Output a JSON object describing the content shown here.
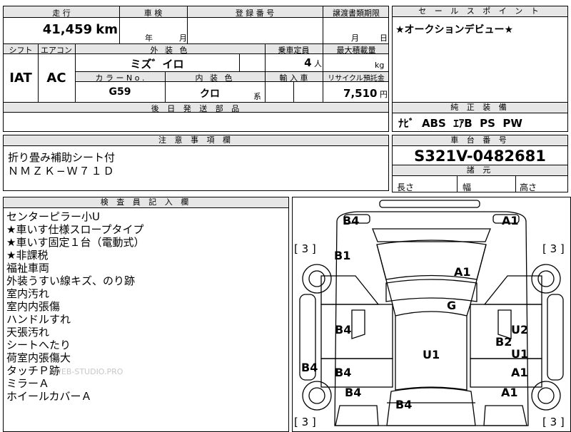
{
  "mileage": {
    "label": "走 行",
    "value": "41,459",
    "unit": "km"
  },
  "inspection": {
    "label": "車 検",
    "year_unit": "年",
    "month_unit": "月"
  },
  "registration": {
    "label": "登 録 番 号"
  },
  "transfer_deadline": {
    "label": "譲渡書類期限",
    "month_unit": "月",
    "day_unit": "日"
  },
  "shift": {
    "label": "シフト",
    "value": "IAT"
  },
  "aircon": {
    "label": "エアコン",
    "value": "AC"
  },
  "exterior_color": {
    "label": "外 装 色",
    "value": "ミズ゛イロ"
  },
  "seating": {
    "label": "乗車定員",
    "value": "4",
    "unit": "人"
  },
  "max_load": {
    "label": "最大積載量",
    "unit": "kg"
  },
  "color_no": {
    "label": "カ ラ ー N o .",
    "value": "G59"
  },
  "interior_color": {
    "label": "内 装 色",
    "value": "クロ",
    "suffix": "系"
  },
  "import": {
    "label": "輸 入 車"
  },
  "recycle": {
    "label": "リサイクル預託金",
    "value": "7,510",
    "unit": "円"
  },
  "later_parts": {
    "label": "後 日 発 送 部 品"
  },
  "sales_point": {
    "label": "セ ー ル ス ポ イ ン ト",
    "text": "★オークションデビュー★"
  },
  "factory_equipment": {
    "label": "純 正 装 備",
    "text": "ﾅﾋﾞ  ABS  ｴｱB  PS  PW"
  },
  "notes": {
    "label": "注 意 事 項 欄",
    "lines": [
      "折り畳み補助シート付",
      "ＮＭＺＫ−Ｗ７１Ｄ"
    ]
  },
  "chassis": {
    "label": "車 台 番 号",
    "value": "S321V-0482681"
  },
  "specs": {
    "label": "諸 元",
    "length": "長さ",
    "width": "幅",
    "height": "高さ"
  },
  "inspector": {
    "label": "検 査 員 記 入 欄",
    "lines": [
      "センターピラー小U",
      "★車いす仕様スロープタイプ",
      "★車いす固定１台（電動式）",
      "★非課税",
      "福祉車両",
      "外装うすい線キズ、のり跡",
      "室内汚れ",
      "室内内張傷",
      "ハンドルすれ",
      "天張汚れ",
      "シートへたり",
      "荷室内張傷大",
      "タッチＰ跡",
      "ミラーＡ",
      "ホイールカバーＡ"
    ]
  },
  "watermark": "WEB-STUDIO.PRO",
  "damage_map": {
    "marks": [
      "B4",
      "A1",
      "B1",
      "A1",
      "G",
      "B4",
      "U2",
      "B2",
      "U1",
      "U1",
      "B4",
      "B4",
      "A1",
      "B4",
      "A1",
      "B4"
    ],
    "tire_brackets": [
      "[ 3 ]",
      "[ 3 ]",
      "[ 3 ]",
      "[ 3 ]"
    ]
  }
}
